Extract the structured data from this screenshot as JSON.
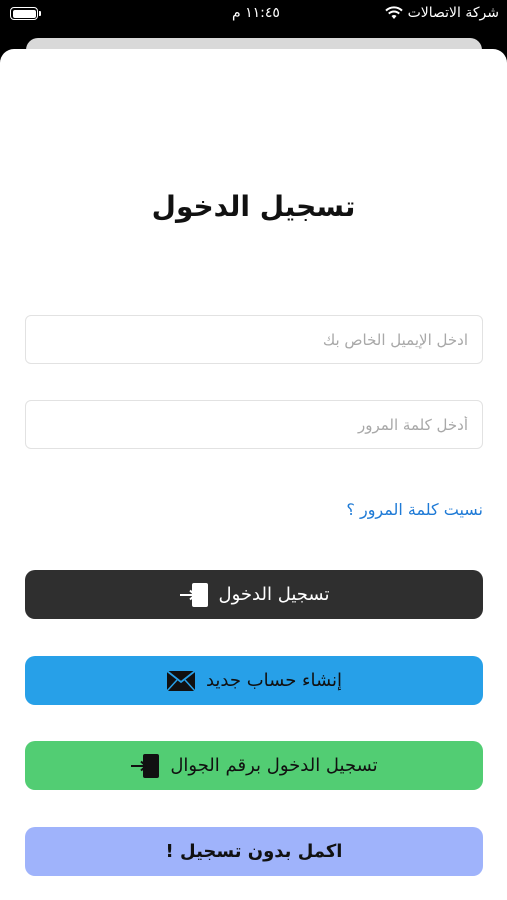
{
  "status_bar": {
    "carrier": "شركة الاتصالات",
    "time": "١١:٤٥ م"
  },
  "login": {
    "title": "تسجيل الدخول",
    "email": {
      "placeholder": "ادخل الإيميل الخاص بك",
      "value": ""
    },
    "password": {
      "placeholder": "أدخل كلمة المرور",
      "value": ""
    },
    "forgot_password": "نسيت كلمة المرور ؟",
    "buttons": {
      "login": "تسجيل الدخول",
      "register": "إنشاء حساب جديد",
      "phone_login": "تسجيل الدخول برقم الجوال",
      "guest": "اكمل  بدون تسجيل !"
    },
    "icons": {
      "login": "login-icon",
      "register": "envelope-icon",
      "phone_login": "login-icon",
      "battery": "battery-icon",
      "wifi": "wifi-icon"
    }
  }
}
